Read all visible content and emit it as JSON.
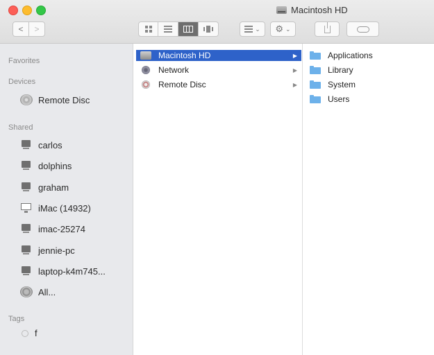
{
  "window": {
    "title": "Macintosh HD"
  },
  "toolbar": {
    "back_label": "<",
    "forward_label": ">",
    "arrange_chevron": "⌄",
    "action_chevron": "⌄",
    "views": [
      "icon-view",
      "list-view",
      "column-view",
      "cover-flow-view"
    ],
    "active_view": "column-view"
  },
  "sidebar": {
    "favorites_header": "Favorites",
    "devices_header": "Devices",
    "devices": [
      {
        "label": "Remote Disc",
        "icon": "disc-icon"
      }
    ],
    "shared_header": "Shared",
    "shared": [
      {
        "label": "carlos",
        "icon": "pc-icon"
      },
      {
        "label": "dolphins",
        "icon": "pc-icon"
      },
      {
        "label": "graham",
        "icon": "pc-icon"
      },
      {
        "label": "iMac (14932)",
        "icon": "imac-icon"
      },
      {
        "label": "imac-25274",
        "icon": "pc-icon"
      },
      {
        "label": "jennie-pc",
        "icon": "pc-icon"
      },
      {
        "label": "laptop-k4m745...",
        "icon": "pc-icon"
      },
      {
        "label": "All...",
        "icon": "network-globe-icon"
      }
    ],
    "tags_header": "Tags",
    "tags": [
      {
        "label": "f",
        "color": "#ffffff"
      }
    ]
  },
  "columns": {
    "col1": [
      {
        "label": "Macintosh HD",
        "selected": true,
        "icon": "hard-drive-icon"
      },
      {
        "label": "Network",
        "selected": false,
        "icon": "network-icon"
      },
      {
        "label": "Remote Disc",
        "selected": false,
        "icon": "remote-disc-icon"
      }
    ],
    "col2": [
      {
        "label": "Applications",
        "icon": "folder-icon"
      },
      {
        "label": "Library",
        "icon": "folder-icon"
      },
      {
        "label": "System",
        "icon": "folder-icon"
      },
      {
        "label": "Users",
        "icon": "folder-icon"
      }
    ]
  },
  "colors": {
    "selection": "#2e62c9",
    "sidebar_bg": "#e8e9ec",
    "folder": "#6db1ea"
  }
}
